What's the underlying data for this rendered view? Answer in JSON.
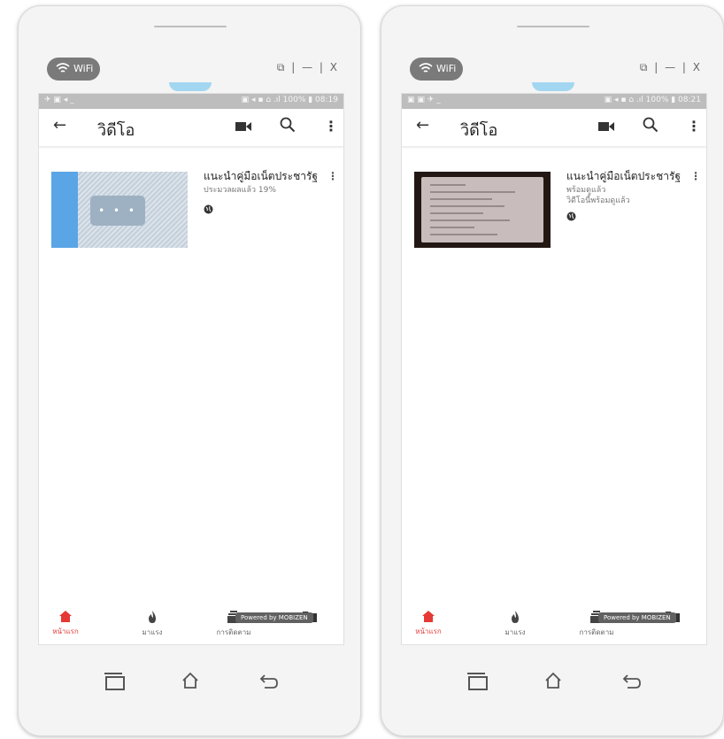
{
  "phones": [
    {
      "wifi_label": "WiFi",
      "window_controls": "⧉ | — | X",
      "status_left": "✈ ▣ ◂ _",
      "status_right": "▣ ◂ ▪ ⌂ .ıl 100% ▮ 08:19",
      "app_title": "วิดีโอ",
      "video": {
        "title": "แนะนำคู่มือเน็ตประชารัฐ",
        "line1": "ประมวลผลแล้ว 19%",
        "line2": ""
      },
      "nav": [
        "หน้าแรก",
        "มาแรง",
        "การติดตาม",
        ""
      ],
      "powered_by": "Powered by MOBIZEN"
    },
    {
      "wifi_label": "WiFi",
      "window_controls": "⧉ | — | X",
      "status_left": "▣ ▣ ✈ _",
      "status_right": "▣ ◂ ▪ ⌂ .ıl 100% ▮ 08:21",
      "app_title": "วิดีโอ",
      "video": {
        "title": "แนะนำคู่มือเน็ตประชารัฐ",
        "line1": "พร้อมดูแล้ว",
        "line2": "วิดีโอนี้พร้อมดูแล้ว"
      },
      "nav": [
        "หน้าแรก",
        "มาแรง",
        "การติดตาม",
        ""
      ],
      "powered_by": "Powered by MOBIZEN"
    }
  ],
  "colors": {
    "accent_red": "#e53935",
    "progress_blue": "#5aa5e6"
  }
}
